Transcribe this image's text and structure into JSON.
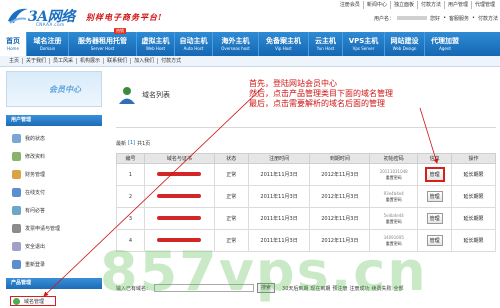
{
  "header": {
    "logo_text": "3A网络",
    "logo_domain": "CNAAA.com",
    "slogan": "别样电子商务平台!",
    "toplinks": [
      "注册会员",
      "新闻中心",
      "独立面板",
      "付款方法",
      "用户管理",
      "代理管理"
    ],
    "user_label": "用户名：",
    "user_links": [
      "您好",
      "客服服务",
      "付款方法"
    ]
  },
  "nav": {
    "badge": "热销",
    "items": [
      {
        "cn": "首页",
        "en": "Home"
      },
      {
        "cn": "域名注册",
        "en": "Domain"
      },
      {
        "cn": "服务器租用托管",
        "en": "Server Host"
      },
      {
        "cn": "虚拟主机",
        "en": "Web Host"
      },
      {
        "cn": "自动主机",
        "en": "Auto Host"
      },
      {
        "cn": "海外主机",
        "en": "Overseas host"
      },
      {
        "cn": "免备案主机",
        "en": "Vip Host"
      },
      {
        "cn": "云主机",
        "en": "Yun Host"
      },
      {
        "cn": "VPS主机",
        "en": "Vps Server"
      },
      {
        "cn": "网站建设",
        "en": "Web Design"
      },
      {
        "cn": "代理加盟",
        "en": "Agent"
      }
    ]
  },
  "subnav": [
    "主页",
    "关于我们",
    "员工风采",
    "机构展示",
    "联系我们",
    "加入我们",
    "付款方式"
  ],
  "sidebar": {
    "banner_text": "会员中心",
    "user_section": "用户管理",
    "user_items": [
      "我的状态",
      "修改资料",
      "财务管理",
      "在线支付",
      "有问必答",
      "发票申请与管理",
      "安全退出",
      "重新登录"
    ],
    "product_section": "产品管理",
    "product_items": [
      "域名管理"
    ]
  },
  "content": {
    "title": "域名列表",
    "pager": [
      "最新",
      "[1]",
      "共1页"
    ],
    "columns": [
      "编号",
      "域名与证书",
      "状态",
      "注册时间",
      "到期时间",
      "初始密码",
      "信息",
      "操作"
    ],
    "rows": [
      {
        "id": "1",
        "status": "正常",
        "reg": "2011年11月3日",
        "exp": "2012年11月3日",
        "pwd_code": "20111031048",
        "pwd_label": "重置密码",
        "info": "管理",
        "op": "延长期限"
      },
      {
        "id": "2",
        "status": "正常",
        "reg": "2011年11月3日",
        "exp": "2012年11月3日",
        "pwd_code": "93e4b4e4",
        "pwd_label": "重置密码",
        "info": "管理",
        "op": "延长期限"
      },
      {
        "id": "3",
        "status": "正常",
        "reg": "2011年11月3日",
        "exp": "2012年11月3日",
        "pwd_code": "5e4b4e44",
        "pwd_label": "重置密码",
        "info": "管理",
        "op": "延长期限"
      },
      {
        "id": "4",
        "status": "正常",
        "reg": "2011年11月3日",
        "exp": "2012年11月3日",
        "pwd_code": "34091695",
        "pwd_label": "重置密码",
        "info": "管理",
        "op": "延长期限"
      }
    ],
    "search_label": "输入已有域名：",
    "search_button": "搜索",
    "filters": [
      "30天后到期",
      "现在到期",
      "预注册",
      "注册成功",
      "续费失败",
      "全部"
    ]
  },
  "annotation": [
    "首先，登陆网站会员中心",
    "然后，点击产品管理类目下面的域名管理",
    "最后，点击需要解析的域名后面的管理"
  ],
  "watermark": "857vps.cn",
  "colors": {
    "nav_blue": "#1567b3",
    "annotation_red": "#d01313",
    "watermark_green": "#5abe50"
  }
}
